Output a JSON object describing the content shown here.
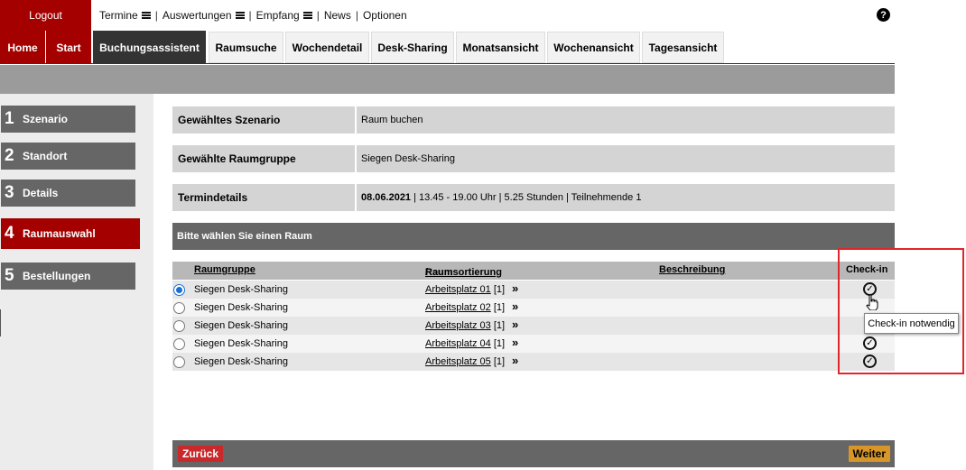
{
  "header": {
    "logout_label": "Logout",
    "menu": [
      {
        "label": "Termine",
        "has_menu": true
      },
      {
        "label": "Auswertungen",
        "has_menu": true
      },
      {
        "label": "Empfang",
        "has_menu": true
      },
      {
        "label": "News",
        "has_menu": false
      },
      {
        "label": "Optionen",
        "has_menu": false
      }
    ],
    "separator": "|",
    "help_label": "?"
  },
  "tabs": [
    {
      "label": "Home"
    },
    {
      "label": "Start"
    },
    {
      "label": "Buchungsassistent"
    },
    {
      "label": "Raumsuche"
    },
    {
      "label": "Wochendetail"
    },
    {
      "label": "Desk-Sharing"
    },
    {
      "label": "Monatsansicht"
    },
    {
      "label": "Wochenansicht"
    },
    {
      "label": "Tagesansicht"
    }
  ],
  "steps": [
    {
      "num": "1",
      "label": "Szenario"
    },
    {
      "num": "2",
      "label": "Standort"
    },
    {
      "num": "3",
      "label": "Details"
    },
    {
      "num": "4",
      "label": "Raumauswahl"
    },
    {
      "num": "5",
      "label": "Bestellungen"
    }
  ],
  "info": {
    "szenario_key": "Gewähltes Szenario",
    "szenario_val": "Raum buchen",
    "raumgruppe_key": "Gewählte Raumgruppe",
    "raumgruppe_val": "Siegen Desk-Sharing",
    "termin_key": "Termindetails",
    "termin_date": "08.06.2021",
    "termin_rest": "| 13.45 - 19.00 Uhr | 5.25 Stunden | Teilnehmende 1"
  },
  "selection_header": "Bitte wählen Sie einen Raum",
  "table": {
    "col_group": "Raumgruppe",
    "col_room": "Raum",
    "col_slash": "/",
    "col_sort": "Raumsortierung",
    "col_desc": "Beschreibung",
    "col_checkin": "Check-in",
    "rows": [
      {
        "group": "Siegen Desk-Sharing",
        "room": "Arbeitsplatz 01",
        "cap": "[1]",
        "chev": "»",
        "check": "✓"
      },
      {
        "group": "Siegen Desk-Sharing",
        "room": "Arbeitsplatz 02",
        "cap": "[1]",
        "chev": "»",
        "check": ""
      },
      {
        "group": "Siegen Desk-Sharing",
        "room": "Arbeitsplatz 03",
        "cap": "[1]",
        "chev": "»",
        "check": ""
      },
      {
        "group": "Siegen Desk-Sharing",
        "room": "Arbeitsplatz 04",
        "cap": "[1]",
        "chev": "»",
        "check": "✓"
      },
      {
        "group": "Siegen Desk-Sharing",
        "room": "Arbeitsplatz 05",
        "cap": "[1]",
        "chev": "»",
        "check": "✓"
      }
    ]
  },
  "tooltip": "Check-in notwendig",
  "buttons": {
    "back": "Zurück",
    "next": "Weiter"
  },
  "colors": {
    "brand_red": "#a50000",
    "dark_gray": "#666666",
    "radio_blue": "#1a6fd6",
    "highlight": "#e0262b",
    "next_orange": "#d79627"
  }
}
